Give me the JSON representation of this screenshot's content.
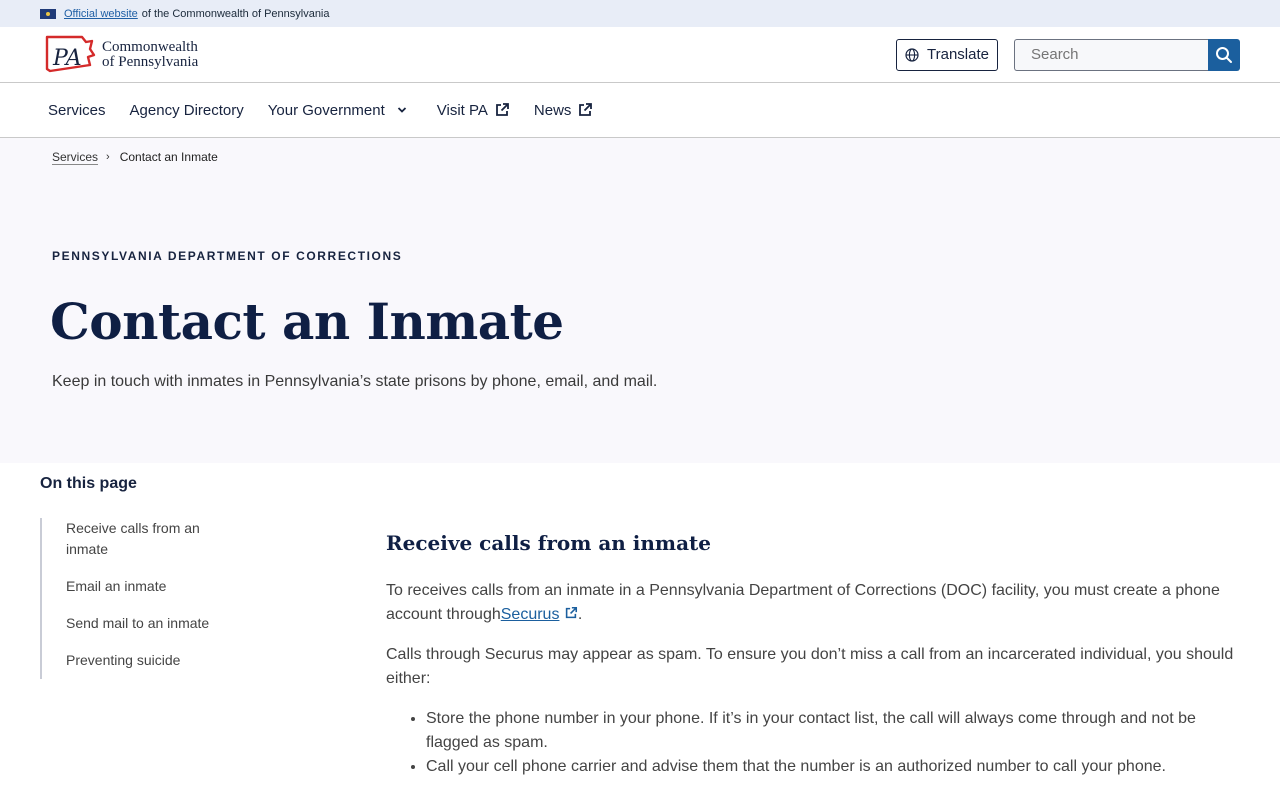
{
  "official": {
    "link_text": "Official website",
    "rest_text": "of the Commonwealth of Pennsylvania"
  },
  "header": {
    "logo_mark": "PA",
    "logo_line1": "Commonwealth",
    "logo_line2": "of Pennsylvania",
    "translate_label": "Translate",
    "search_placeholder": "Search"
  },
  "nav": {
    "items": [
      {
        "label": "Services"
      },
      {
        "label": "Agency Directory"
      },
      {
        "label": "Your Government"
      },
      {
        "label": "Visit PA"
      },
      {
        "label": "News"
      }
    ]
  },
  "breadcrumb": {
    "parent": "Services",
    "current": "Contact an Inmate"
  },
  "hero": {
    "eyebrow": "PENNSYLVANIA DEPARTMENT OF CORRECTIONS",
    "title": "Contact an Inmate",
    "lead": "Keep in touch with inmates in Pennsylvania’s state prisons by phone, email, and mail."
  },
  "on_this_page": {
    "title": "On this page",
    "items": [
      {
        "label": "Receive calls from an inmate"
      },
      {
        "label": "Email an inmate"
      },
      {
        "label": "Send mail to an inmate"
      },
      {
        "label": "Preventing suicide"
      }
    ]
  },
  "section": {
    "heading": "Receive calls from an inmate",
    "p1_before": "To receives calls from an inmate in a Pennsylvania Department of Corrections (DOC) facility, you must create a phone account through",
    "p1_link": "Securus",
    "p1_after": ".",
    "p2": "Calls through Securus may appear as spam. To ensure you don’t miss a call from an incarcerated individual, you should either:",
    "bullets": [
      "Store the phone number in your phone. If it’s in your contact list, the call will always come through and not be flagged as spam.",
      "Call your cell phone carrier and advise them that the number is an authorized number to call your phone."
    ]
  },
  "colors": {
    "navy": "#0f1f44",
    "link_blue": "#1b5f9e",
    "banner_bg": "#e8edf7",
    "hero_bg": "#f9f8fc",
    "logo_red": "#d42a2a"
  }
}
